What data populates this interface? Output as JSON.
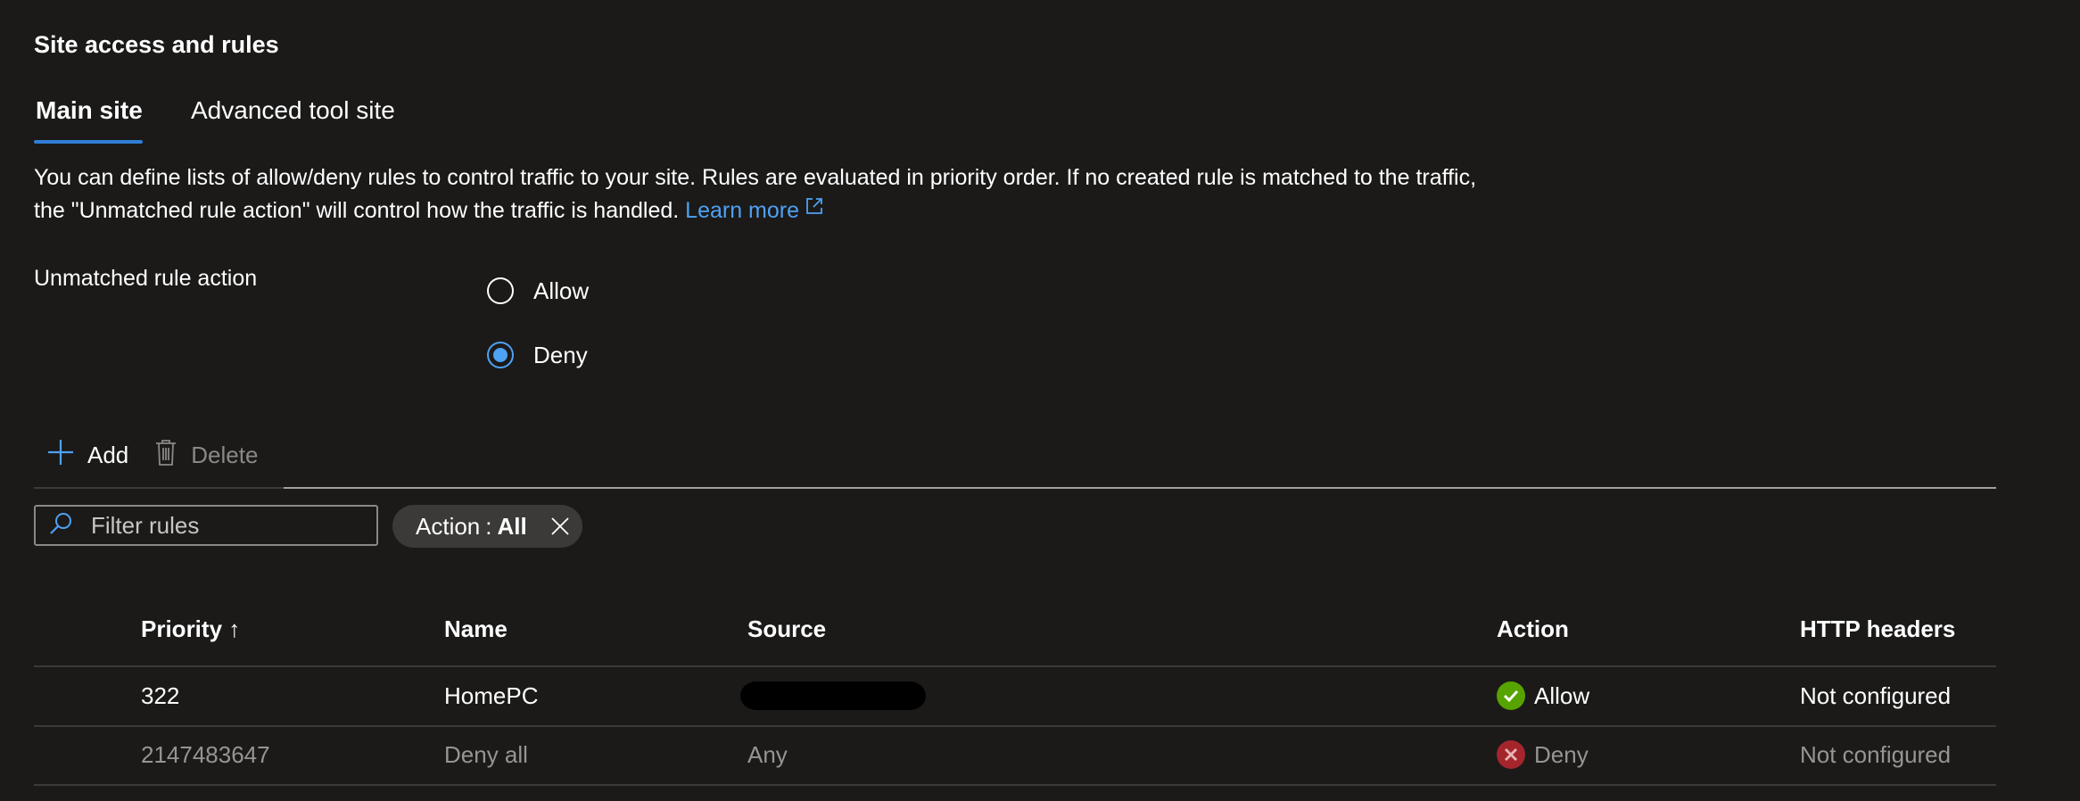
{
  "section_title": "Site access and rules",
  "tabs": [
    {
      "label": "Main site",
      "selected": true
    },
    {
      "label": "Advanced tool site",
      "selected": false
    }
  ],
  "description": {
    "text": "You can define lists of allow/deny rules to control traffic to your site. Rules are evaluated in priority order. If no created rule is matched to the traffic, the \"Unmatched rule action\" will control how the traffic is handled.",
    "link_label": "Learn more"
  },
  "unmatched_rule_action": {
    "label": "Unmatched rule action",
    "options": [
      {
        "label": "Allow",
        "selected": false
      },
      {
        "label": "Deny",
        "selected": true
      }
    ]
  },
  "toolbar": {
    "add_label": "Add",
    "delete_label": "Delete"
  },
  "filter": {
    "placeholder": "Filter rules",
    "value": ""
  },
  "filter_pill": {
    "key": "Action",
    "separator": ":",
    "value": "All"
  },
  "table": {
    "columns": [
      "Priority ↑",
      "Name",
      "Source",
      "Action",
      "HTTP headers"
    ],
    "rows": [
      {
        "priority": "322",
        "name": "HomePC",
        "source": "",
        "source_redacted": true,
        "action": "Allow",
        "action_icon": "check-circle-icon",
        "http_headers": "Not configured"
      },
      {
        "priority": "2147483647",
        "name": "Deny all",
        "source": "Any",
        "source_redacted": false,
        "action": "Deny",
        "action_icon": "error-circle-icon",
        "http_headers": "Not configured"
      }
    ]
  },
  "colors": {
    "background": "#1b1a19",
    "accent": "#4ea1f3",
    "allow_green": "#57a300",
    "deny_red": "#a4262c"
  }
}
